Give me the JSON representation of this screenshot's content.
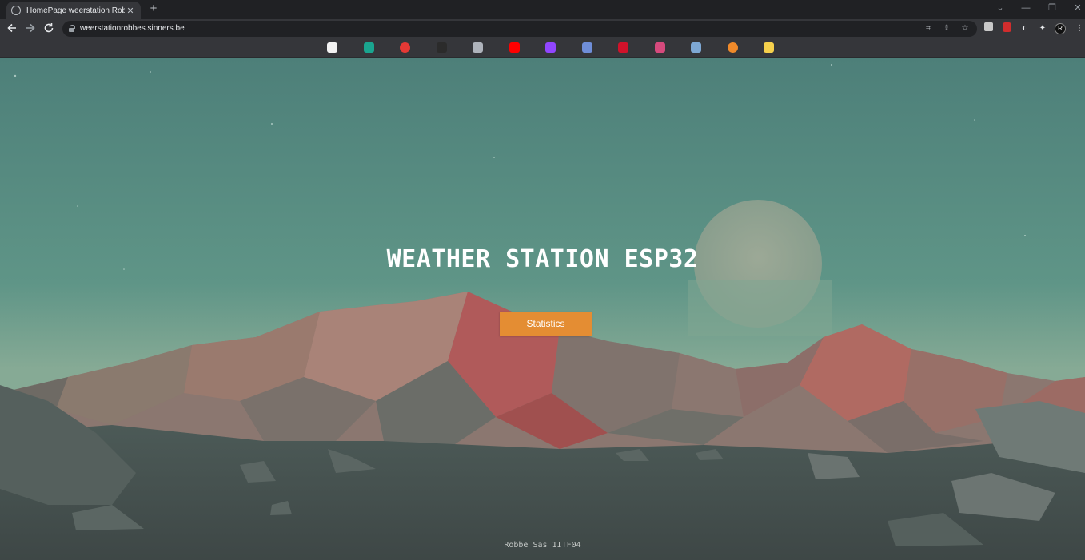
{
  "browser": {
    "tab": {
      "title": "HomePage weerstation Robbe",
      "favicon": "globe-icon",
      "close": "✕"
    },
    "new_tab": "+",
    "url": "weerstationrobbes.sinners.be",
    "window_controls": {
      "minimize": "—",
      "maximize": "❐",
      "close": "✕"
    }
  },
  "bookmarks": [
    {
      "icon": "bookmark-1-icon",
      "color": "#f2f2f2"
    },
    {
      "icon": "bookmark-2-icon",
      "color": "#1aa58f"
    },
    {
      "icon": "bookmark-3-icon",
      "color": "#e53935"
    },
    {
      "icon": "bookmark-4-icon",
      "color": "#2b2b2b"
    },
    {
      "icon": "bookmark-5-icon",
      "color": "#aeb3bb"
    },
    {
      "icon": "bookmark-youtube-icon",
      "color": "#ff0000"
    },
    {
      "icon": "bookmark-twitch-icon",
      "color": "#9146ff"
    },
    {
      "icon": "bookmark-7-icon",
      "color": "#6f8ed8"
    },
    {
      "icon": "bookmark-8-icon",
      "color": "#d0122a"
    },
    {
      "icon": "bookmark-gmail-icon",
      "color": "#d64a7d"
    },
    {
      "icon": "bookmark-steam-icon",
      "color": "#7ea8d4"
    },
    {
      "icon": "bookmark-11-icon",
      "color": "#f08a2a"
    },
    {
      "icon": "bookmark-notes-icon",
      "color": "#f5d04c"
    }
  ],
  "page": {
    "title": "WEATHER STATION ESP32",
    "button_label": "Statistics",
    "footer": "Robbe Sas 1ITF04",
    "accent_color": "#e48d33"
  }
}
